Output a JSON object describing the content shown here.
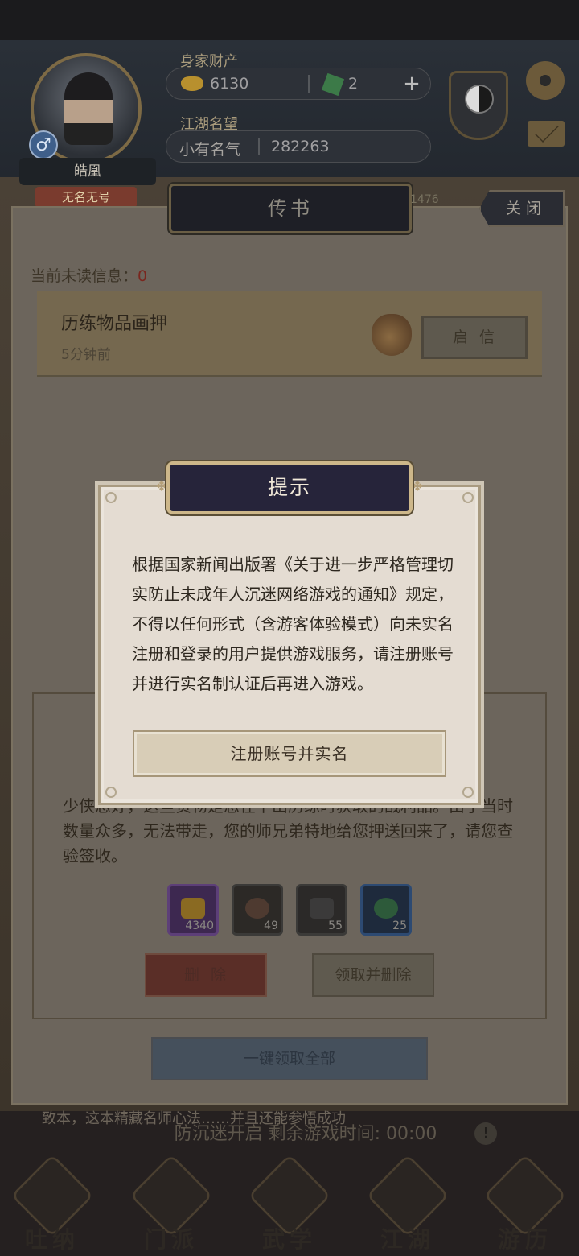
{
  "hud": {
    "player_name": "皓凰",
    "player_title": "无名无号",
    "assets_label": "身家财产",
    "silver_amount": "6130",
    "jade_amount": "2",
    "plus": "+",
    "fame_label": "江湖名望",
    "fame_rank": "小有名气",
    "fame_value": "282263",
    "gender_symbol": "♂"
  },
  "letters_panel": {
    "title": "传书",
    "close_label": "关闭",
    "faded_count": "1476",
    "unread_label": "当前未读信息：",
    "unread_count": "0",
    "item": {
      "title": "历练物品画押",
      "time": "5分钟前",
      "open_label": "启信"
    },
    "detail_text": "少侠您好，这些货物是您在下山历练时获取的战利品。由于当时数量众多，无法带走，您的师兄弟特地给您押送回来了，请您查验签收。",
    "rewards": [
      {
        "qty": "4340",
        "icon": "gold-ingot"
      },
      {
        "qty": "49",
        "icon": "ore"
      },
      {
        "qty": "55",
        "icon": "iron-block"
      },
      {
        "qty": "25",
        "icon": "herb"
      }
    ],
    "delete_label": "删除",
    "claim_delete_label": "领取并删除",
    "claim_all_label": "一键领取全部"
  },
  "background_notice": {
    "faded_text": "致本，这本精藏名师心法……并且还能参悟成功",
    "anti_addiction": "防沉迷开启 剩余游戏时间: 00:00",
    "warn": "!"
  },
  "bottom_nav": [
    {
      "label": "吐纳"
    },
    {
      "label": "门派"
    },
    {
      "label": "武学"
    },
    {
      "label": "江湖"
    },
    {
      "label": "游历"
    }
  ],
  "modal": {
    "title": "提示",
    "body": "根据国家新闻出版署《关于进一步严格管理切实防止未成年人沉迷网络游戏的通知》规定，不得以任何形式（含游客体验模式）向未实名注册和登录的用户提供游戏服务，请注册账号并进行实名制认证后再进入游戏。",
    "button_label": "注册账号并实名"
  },
  "colors": {
    "modal_bg": "#e4dcd2",
    "modal_title_bg": "#26243a",
    "modal_border": "#cdb78a"
  }
}
